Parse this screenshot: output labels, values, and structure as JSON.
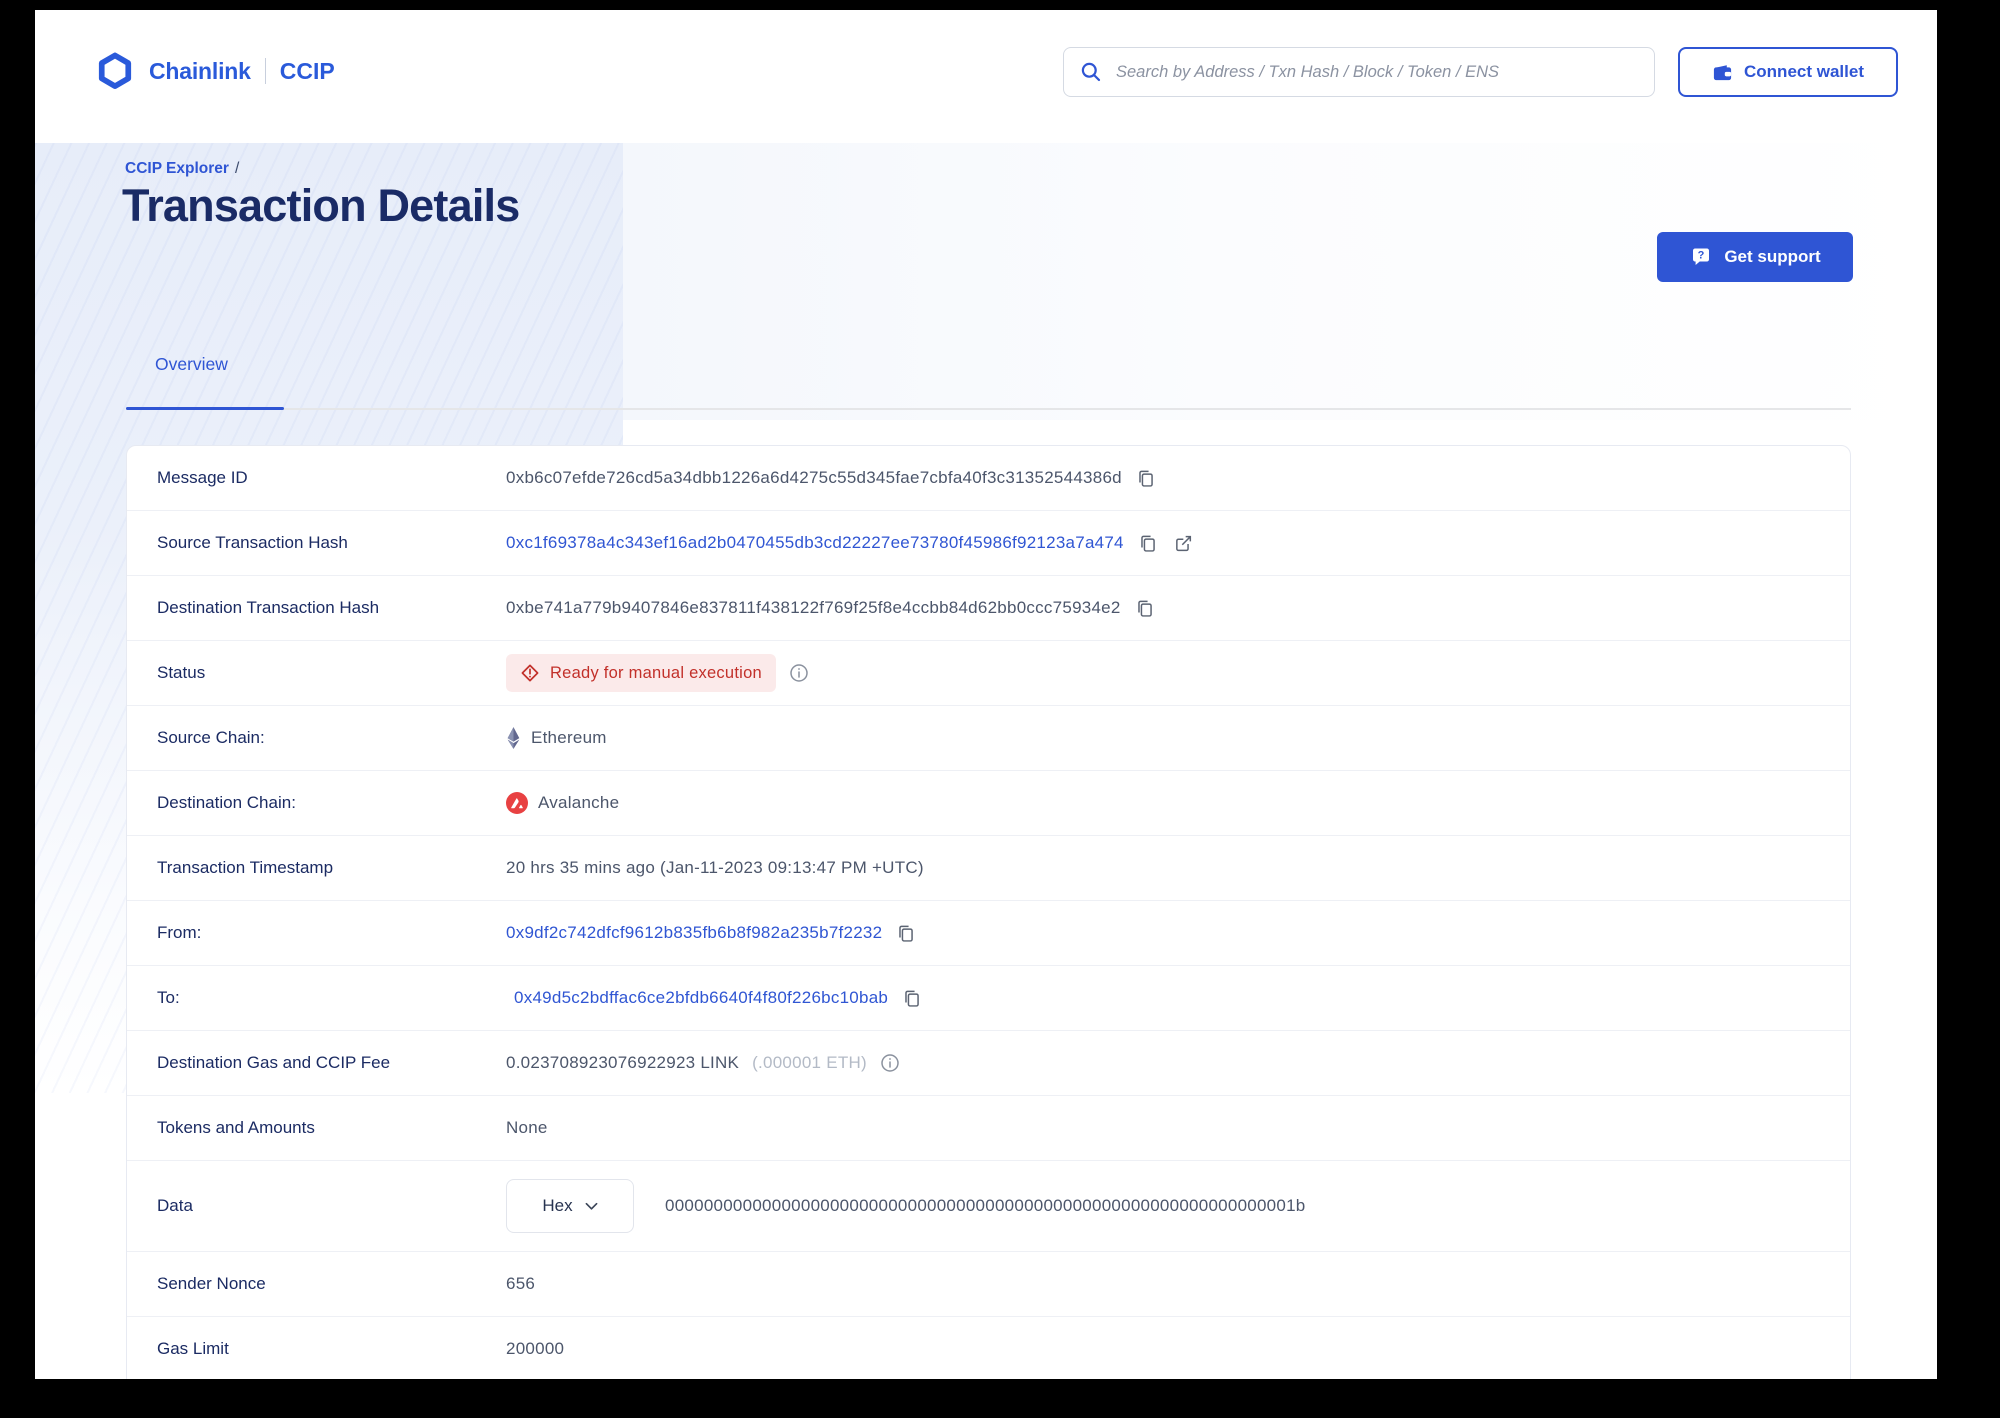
{
  "header": {
    "brand": "Chainlink",
    "product": "CCIP",
    "search_placeholder": "Search by Address / Txn Hash / Block / Token / ENS",
    "connect_wallet": "Connect wallet"
  },
  "breadcrumb": {
    "parent": "CCIP Explorer",
    "separator": "/"
  },
  "hero": {
    "title": "Transaction Details",
    "support_label": "Get support"
  },
  "tabs": {
    "overview": "Overview"
  },
  "details": {
    "message_id": {
      "label": "Message ID",
      "value": "0xb6c07efde726cd5a34dbb1226a6d4275c55d345fae7cbfa40f3c31352544386d"
    },
    "source_tx": {
      "label": "Source Transaction Hash",
      "value": "0xc1f69378a4c343ef16ad2b0470455db3cd22227ee73780f45986f92123a7a474"
    },
    "dest_tx": {
      "label": "Destination Transaction Hash",
      "value": "0xbe741a779b9407846e837811f438122f769f25f8e4ccbb84d62bb0ccc75934e2"
    },
    "status": {
      "label": "Status",
      "value": "Ready for manual execution"
    },
    "source_chain": {
      "label": "Source Chain:",
      "value": "Ethereum"
    },
    "dest_chain": {
      "label": "Destination Chain:",
      "value": "Avalanche"
    },
    "timestamp": {
      "label": "Transaction Timestamp",
      "value": "20 hrs 35 mins ago (Jan-11-2023 09:13:47 PM +UTC)"
    },
    "from": {
      "label": "From:",
      "value": "0x9df2c742dfcf9612b835fb6b8f982a235b7f2232"
    },
    "to": {
      "label": "To:",
      "value": "0x49d5c2bdffac6ce2bfdb6640f4f80f226bc10bab"
    },
    "fee": {
      "label": "Destination Gas and CCIP Fee",
      "value": "0.023708923076922923 LINK",
      "secondary": "(.000001 ETH)"
    },
    "tokens": {
      "label": "Tokens and Amounts",
      "value": "None"
    },
    "data": {
      "label": "Data",
      "format": "Hex",
      "value": "00000000000000000000000000000000000000000000000000000000000000001b"
    },
    "nonce": {
      "label": "Sender Nonce",
      "value": "656"
    },
    "gas_limit": {
      "label": "Gas Limit",
      "value": "200000"
    }
  },
  "colors": {
    "accent_blue": "#2f55d4",
    "link_blue": "#3056d3",
    "heading_navy": "#1a2b66",
    "value_gray": "#4c566b",
    "status_red": "#c2302a",
    "status_bg": "#fbeaea",
    "avalanche_red": "#e84142"
  }
}
